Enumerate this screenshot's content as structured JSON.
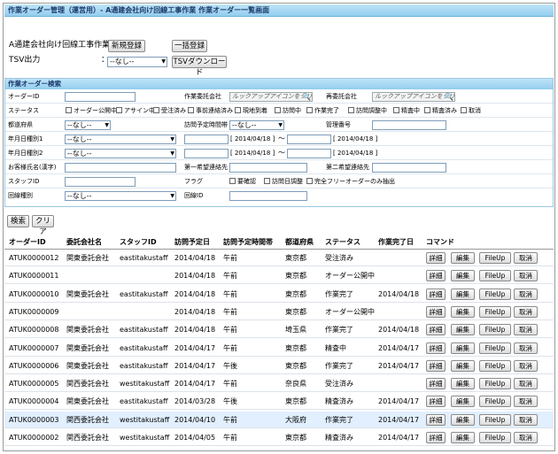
{
  "header": {
    "title": "作業オーダー管理（運営用）- A通建会社向け回線工事作業  作業オーダー一覧画面"
  },
  "top": {
    "work_label": "A通建会社向け回線工事作業：",
    "new_button": "新規登録",
    "bulk_button": "一括登録",
    "tsv_label": "TSV出力",
    "colon": "：",
    "tsv_select": "--なし--",
    "tsv_download_button": "TSVダウンロード"
  },
  "search": {
    "header": "作業オーダー検索",
    "order_id_label": "オーダーID",
    "consignor_label": "作業委託会社",
    "consignor_lookup": "ルックアップアイコンをクリック",
    "reconsignor_label": "再委託会社",
    "reconsignor_lookup": "ルックアップアイコンをクリック",
    "status_label": "ステータス",
    "statuses": [
      "オーダー公開中",
      "アサイン中",
      "受注済み",
      "事前連絡済み",
      "現地到着",
      "訪問中",
      "作業完了",
      "訪問調整中",
      "精査中",
      "精査済み",
      "取消"
    ],
    "pref_label": "都道府県",
    "pref_value": "--なし--",
    "visit_slot_label": "訪問予定時間帯",
    "visit_slot_value": "--なし--",
    "mgmt_no_label": "管理番号",
    "date_type1_label": "年月日種別1",
    "date_type1_value": "--なし--",
    "date_type2_label": "年月日種別2",
    "date_type2_value": "--なし--",
    "date_hint": "[ 2014/04/18 ]",
    "tilde": "～",
    "customer_label": "お客様氏名(漢字)",
    "first_visit_label": "第一希望連絡先",
    "second_visit_label": "第二希望連絡先",
    "staff_label": "スタッフID",
    "flag_label": "フラグ",
    "flags": [
      "要確認",
      "訪問日調整",
      "完全フリーオーダーのみ抽出"
    ],
    "circuit_type_label": "回線種別",
    "circuit_type_value": "--なし--",
    "circuit_id_label": "回線ID",
    "search_button": "検索",
    "clear_button": "クリア"
  },
  "table": {
    "columns": [
      "オーダーID",
      "委託会社名",
      "スタッフID",
      "訪問予定日",
      "訪問予定時間帯",
      "都道府県",
      "ステータス",
      "作業完了日",
      "コマンド"
    ],
    "buttons": {
      "detail": "詳細",
      "edit": "編集",
      "fileup": "FileUp",
      "cancel": "取消"
    },
    "rows": [
      {
        "id": "ATUK0000012",
        "company": "関東委託会社",
        "staff": "eastitakustaff",
        "date": "2014/04/18",
        "slot": "午前",
        "pref": "東京都",
        "status": "受注済み",
        "done": ""
      },
      {
        "id": "ATUK0000011",
        "company": "",
        "staff": "",
        "date": "2014/04/18",
        "slot": "午前",
        "pref": "東京都",
        "status": "オーダー公開中",
        "done": ""
      },
      {
        "id": "ATUK0000010",
        "company": "関東委託会社",
        "staff": "eastitakustaff",
        "date": "2014/04/18",
        "slot": "午前",
        "pref": "東京都",
        "status": "作業完了",
        "done": "2014/04/18"
      },
      {
        "id": "ATUK0000009",
        "company": "",
        "staff": "",
        "date": "2014/04/18",
        "slot": "午前",
        "pref": "東京都",
        "status": "オーダー公開中",
        "done": ""
      },
      {
        "id": "ATUK0000008",
        "company": "関東委託会社",
        "staff": "eastitakustaff",
        "date": "2014/04/18",
        "slot": "午前",
        "pref": "埼玉県",
        "status": "作業完了",
        "done": "2014/04/18"
      },
      {
        "id": "ATUK0000007",
        "company": "関東委託会社",
        "staff": "eastitakustaff",
        "date": "2014/04/17",
        "slot": "午前",
        "pref": "東京都",
        "status": "精査中",
        "done": "2014/04/17"
      },
      {
        "id": "ATUK0000006",
        "company": "関東委託会社",
        "staff": "eastitakustaff",
        "date": "2014/04/17",
        "slot": "午後",
        "pref": "東京都",
        "status": "作業完了",
        "done": "2014/04/17"
      },
      {
        "id": "ATUK0000005",
        "company": "関西委託会社",
        "staff": "westitakustaff",
        "date": "2014/04/17",
        "slot": "午前",
        "pref": "奈良県",
        "status": "受注済み",
        "done": ""
      },
      {
        "id": "ATUK0000004",
        "company": "関東委託会社",
        "staff": "eastitakustaff",
        "date": "2014/03/28",
        "slot": "午後",
        "pref": "東京都",
        "status": "精査済み",
        "done": "2014/04/17"
      },
      {
        "id": "ATUK0000003",
        "company": "関西委託会社",
        "staff": "westitakustaff",
        "date": "2014/04/10",
        "slot": "午前",
        "pref": "大阪府",
        "status": "作業完了",
        "done": "2014/04/17"
      },
      {
        "id": "ATUK0000002",
        "company": "関西委託会社",
        "staff": "westitakustaff",
        "date": "2014/04/05",
        "slot": "午前",
        "pref": "東京都",
        "status": "精査済み",
        "done": "2014/04/17"
      }
    ],
    "highlight_row": 9
  }
}
